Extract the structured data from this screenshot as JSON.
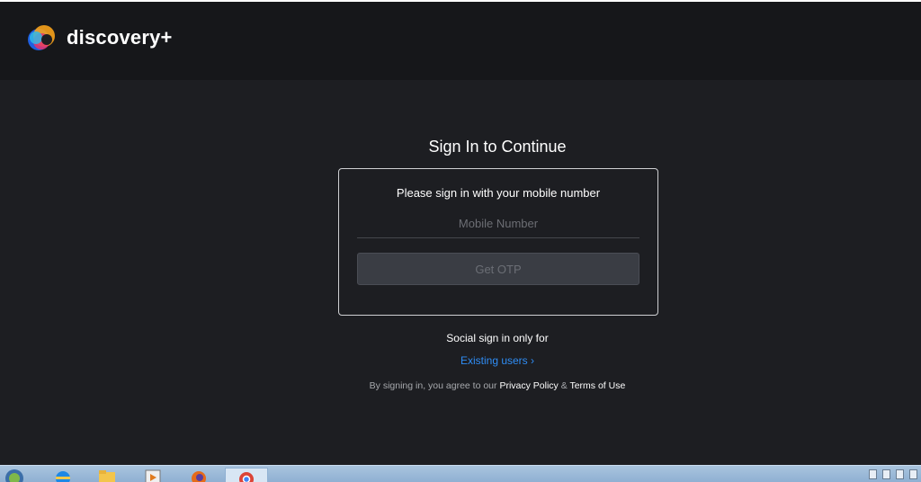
{
  "header": {
    "brand": "discovery+",
    "icons": [
      "discovery-plus-logo-icon"
    ]
  },
  "signin": {
    "title": "Sign In to Continue",
    "card_heading": "Please sign in with your mobile number",
    "mobile_placeholder": "Mobile Number",
    "mobile_value": "",
    "otp_button": "Get OTP",
    "social_text": "Social sign in only for",
    "existing_users": "Existing users",
    "existing_icon": "chevron-right-icon",
    "agree_prefix": "By signing in, you agree to our",
    "privacy_link": "Privacy Policy",
    "ampersand": "&",
    "terms_link": "Terms of Use"
  },
  "taskbar": {
    "items": [
      "windows-start-icon",
      "internet-explorer-icon",
      "file-explorer-icon",
      "media-player-icon",
      "firefox-icon",
      "chrome-icon"
    ]
  },
  "colors": {
    "background": "#1d1e22",
    "header": "#16171a",
    "link": "#2f8df5",
    "button": "#3a3d44"
  }
}
